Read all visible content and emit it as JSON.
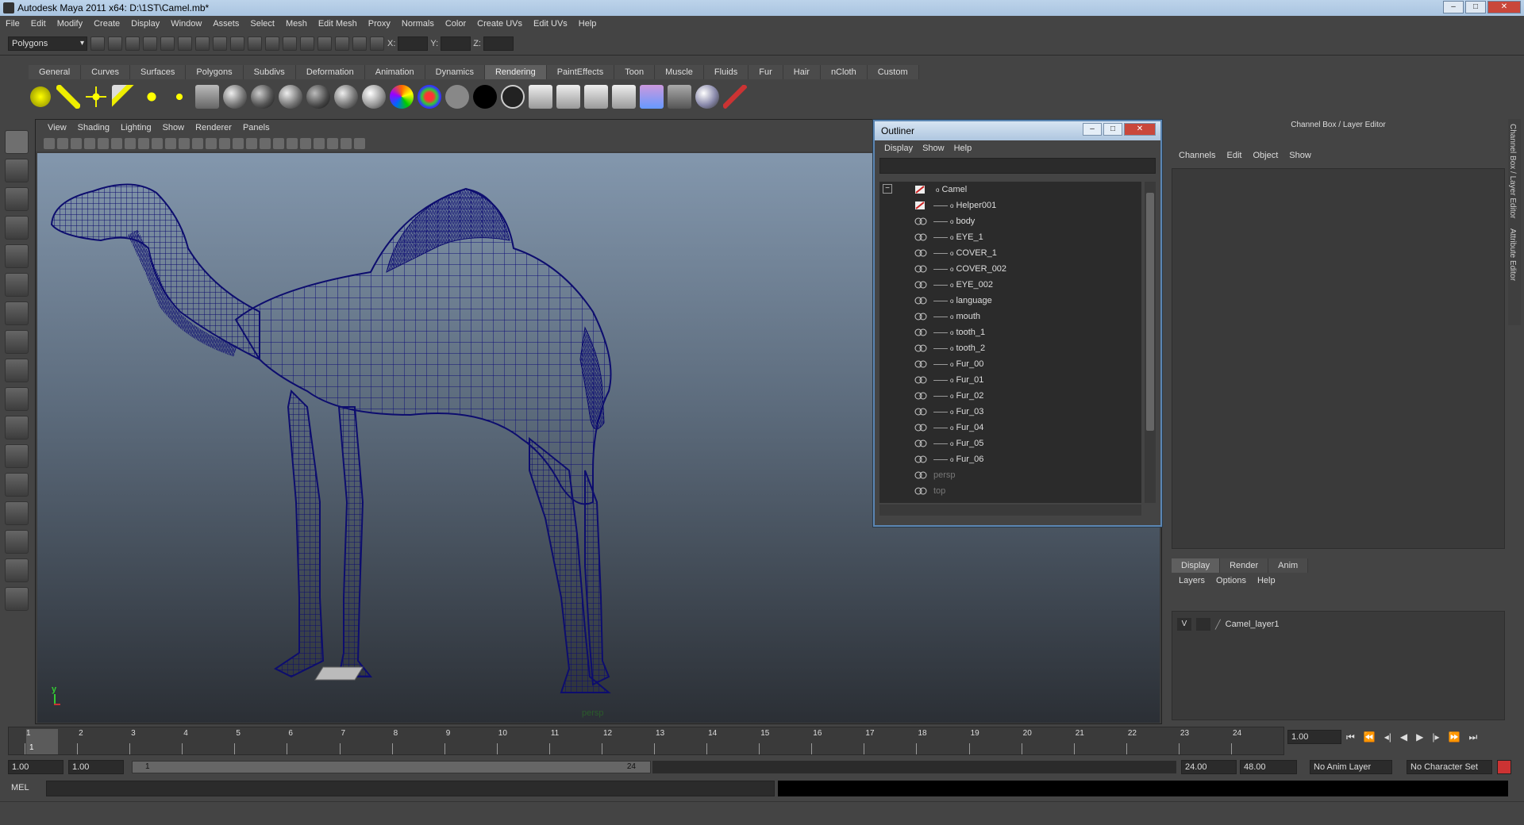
{
  "window": {
    "title": "Autodesk Maya 2011 x64: D:\\1ST\\Camel.mb*"
  },
  "menubar": [
    "File",
    "Edit",
    "Modify",
    "Create",
    "Display",
    "Window",
    "Assets",
    "Select",
    "Mesh",
    "Edit Mesh",
    "Proxy",
    "Normals",
    "Color",
    "Create UVs",
    "Edit UVs",
    "Help"
  ],
  "status": {
    "mode": "Polygons",
    "x_label": "X:",
    "y_label": "Y:",
    "z_label": "Z:"
  },
  "shelf_tabs": [
    "General",
    "Curves",
    "Surfaces",
    "Polygons",
    "Subdivs",
    "Deformation",
    "Animation",
    "Dynamics",
    "Rendering",
    "PaintEffects",
    "Toon",
    "Muscle",
    "Fluids",
    "Fur",
    "Hair",
    "nCloth",
    "Custom"
  ],
  "shelf_active": "Rendering",
  "viewport": {
    "menu": [
      "View",
      "Shading",
      "Lighting",
      "Show",
      "Renderer",
      "Panels"
    ],
    "camera_label": "persp",
    "axis_y": "y",
    "wire_color": "#0d0d6e"
  },
  "outliner": {
    "title": "Outliner",
    "menu": [
      "Display",
      "Show",
      "Help"
    ],
    "items": [
      {
        "label": "Camel",
        "root": true
      },
      {
        "label": "Helper001"
      },
      {
        "label": "body"
      },
      {
        "label": "EYE_1"
      },
      {
        "label": "COVER_1"
      },
      {
        "label": "COVER_002"
      },
      {
        "label": "EYE_002"
      },
      {
        "label": "language"
      },
      {
        "label": "mouth"
      },
      {
        "label": "tooth_1"
      },
      {
        "label": "tooth_2"
      },
      {
        "label": "Fur_00"
      },
      {
        "label": "Fur_01"
      },
      {
        "label": "Fur_02"
      },
      {
        "label": "Fur_03"
      },
      {
        "label": "Fur_04"
      },
      {
        "label": "Fur_05"
      },
      {
        "label": "Fur_06"
      },
      {
        "label": "persp",
        "dim": true
      },
      {
        "label": "top",
        "dim": true
      }
    ]
  },
  "channelbox": {
    "title": "Channel Box / Layer Editor",
    "menu": [
      "Channels",
      "Edit",
      "Object",
      "Show"
    ],
    "layer_tabs": [
      "Display",
      "Render",
      "Anim"
    ],
    "layer_menu": [
      "Layers",
      "Options",
      "Help"
    ],
    "layer": {
      "visible": "V",
      "name": "Camel_layer1"
    },
    "side_tabs": [
      "Channel Box / Layer Editor",
      "Attribute Editor"
    ]
  },
  "timeline": {
    "ticks": [
      "1",
      "2",
      "3",
      "4",
      "5",
      "6",
      "7",
      "8",
      "9",
      "10",
      "11",
      "12",
      "13",
      "14",
      "15",
      "16",
      "17",
      "18",
      "19",
      "20",
      "21",
      "22",
      "23",
      "24"
    ],
    "current": "1",
    "current_field": "1.00"
  },
  "range": {
    "start": "1.00",
    "anim_start": "1.00",
    "slider_start": "1",
    "slider_end": "24",
    "end": "24.00",
    "anim_end": "48.00",
    "anim_layer": "No Anim Layer",
    "char_set": "No Character Set"
  },
  "cmdline": {
    "label": "MEL"
  }
}
